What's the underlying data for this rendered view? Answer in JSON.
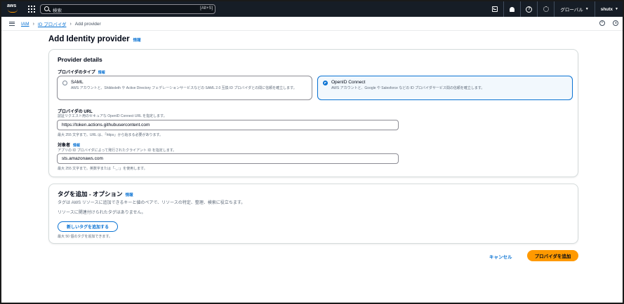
{
  "topnav": {
    "logo_text": "aws",
    "search_placeholder": "検索",
    "search_shortcut": "[Alt+S]",
    "region_label": "グローバル",
    "user_label": "shutx"
  },
  "breadcrumb": {
    "items": [
      "IAM",
      "ID プロバイダ"
    ],
    "current": "Add provider"
  },
  "page": {
    "title": "Add Identity provider",
    "info": "情報"
  },
  "provider_details": {
    "title": "Provider details",
    "type_label": "プロバイダのタイプ",
    "type_info": "情報",
    "options": [
      {
        "title": "SAML",
        "desc": "AWS アカウントと、Shibboleth や Active Directory フェデレーションサービスなどの SAML 2.0 互換 ID プロバイダとの間に信頼を確立します。",
        "selected": false
      },
      {
        "title": "OpenID Connect",
        "desc": "AWS アカウントと、Google や Salesforce などの ID プロバイダサービス間の信頼を確立します。",
        "selected": true
      }
    ],
    "url_label": "プロバイダの URL",
    "url_desc": "認証リクエスト用のセキュアな OpenID Connect URL を指定します。",
    "url_value": "https://token.actions.githubusercontent.com",
    "url_constraint": "最大 255 文字まで。URL は、「https」から始まる必要があります。",
    "audience_label": "対象者",
    "audience_info": "情報",
    "audience_desc": "アプリの ID プロバイダによって発行されたクライアント ID を指定します。",
    "audience_value": "sts.amazonaws.com",
    "audience_constraint": "最大 255 文字まで。英数字または「-_.:」を使用します。"
  },
  "tags": {
    "title": "タグを追加 - オプション",
    "info": "情報",
    "desc": "タグは AWS リソースに追加できるキーと値のペアで、リソースの特定、整理、検索に役立ちます。",
    "empty": "リソースに関連付けられたタグはありません。",
    "add_button": "新しいタグを追加する",
    "limit": "最大 50 個のタグを追加できます。"
  },
  "actions": {
    "cancel": "キャンセル",
    "submit": "プロバイダを追加"
  },
  "colors": {
    "nav_bg": "#161d26",
    "link": "#0972d3",
    "primary_button": "#ff9900"
  }
}
